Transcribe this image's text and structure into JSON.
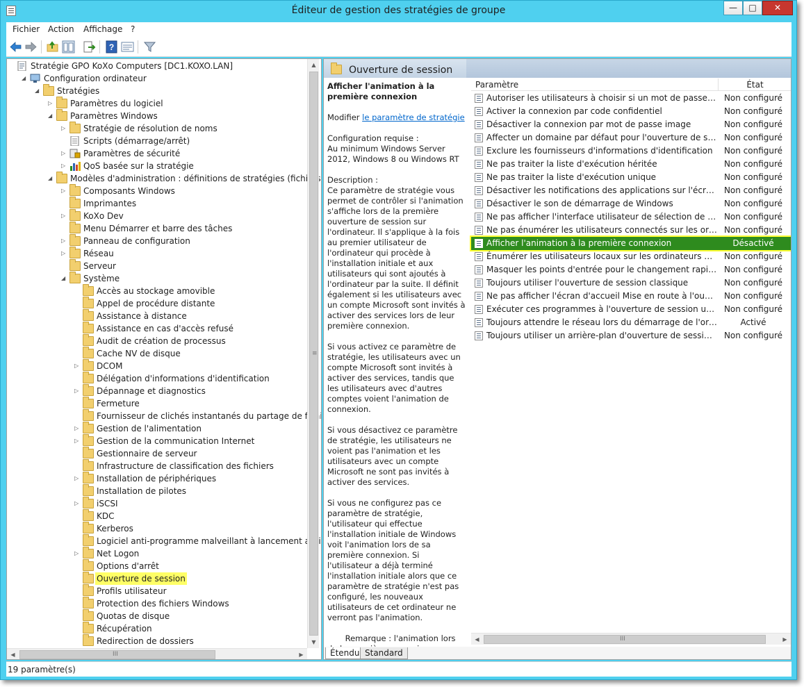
{
  "window": {
    "title": "Éditeur de gestion des stratégies de groupe",
    "min": "—",
    "max": "□",
    "close": "✕"
  },
  "menu": {
    "items": [
      "Fichier",
      "Action",
      "Affichage",
      "?"
    ]
  },
  "toolbar": {
    "icons": [
      "back-icon",
      "forward-icon",
      "up-folder-icon",
      "show-hide-tree-icon",
      "export-list-icon",
      "help-icon",
      "properties-icon",
      "filter-icon"
    ]
  },
  "tree": {
    "items": [
      {
        "label": "Stratégie GPO KoXo Computers [DC1.KOXO.LAN]",
        "icon": "policy-icon",
        "expander": ""
      },
      {
        "label": "Configuration ordinateur",
        "icon": "computer-icon",
        "expander": "◢"
      },
      {
        "label": "Stratégies",
        "icon": "folder-icon",
        "expander": "◢"
      },
      {
        "label": "Paramètres du logiciel",
        "icon": "folder-icon",
        "expander": "▷"
      },
      {
        "label": "Paramètres Windows",
        "icon": "folder-icon",
        "expander": "◢"
      },
      {
        "label": "Stratégie de résolution de noms",
        "icon": "folder-icon",
        "expander": "▷"
      },
      {
        "label": "Scripts (démarrage/arrêt)",
        "icon": "script-icon",
        "expander": ""
      },
      {
        "label": "Paramètres de sécurité",
        "icon": "security-icon",
        "expander": "▷"
      },
      {
        "label": "QoS basée sur la stratégie",
        "icon": "qos-chart-icon",
        "expander": "▷"
      },
      {
        "label": "Modèles d'administration : définitions de stratégies (fichiers ADMX",
        "icon": "folder-icon",
        "expander": "◢"
      },
      {
        "label": "Composants Windows",
        "icon": "folder-icon",
        "expander": "▷"
      },
      {
        "label": "Imprimantes",
        "icon": "folder-icon",
        "expander": ""
      },
      {
        "label": "KoXo Dev",
        "icon": "folder-icon",
        "expander": "▷"
      },
      {
        "label": "Menu Démarrer et barre des tâches",
        "icon": "folder-icon",
        "expander": ""
      },
      {
        "label": "Panneau de configuration",
        "icon": "folder-icon",
        "expander": "▷"
      },
      {
        "label": "Réseau",
        "icon": "folder-icon",
        "expander": "▷"
      },
      {
        "label": "Serveur",
        "icon": "folder-icon",
        "expander": ""
      },
      {
        "label": "Système",
        "icon": "folder-icon",
        "expander": "◢"
      },
      {
        "label": "Accès au stockage amovible",
        "icon": "folder-icon",
        "expander": ""
      },
      {
        "label": "Appel de procédure distante",
        "icon": "folder-icon",
        "expander": ""
      },
      {
        "label": "Assistance à distance",
        "icon": "folder-icon",
        "expander": ""
      },
      {
        "label": "Assistance en cas d'accès refusé",
        "icon": "folder-icon",
        "expander": ""
      },
      {
        "label": "Audit de création de processus",
        "icon": "folder-icon",
        "expander": ""
      },
      {
        "label": "Cache NV de disque",
        "icon": "folder-icon",
        "expander": ""
      },
      {
        "label": "DCOM",
        "icon": "folder-icon",
        "expander": "▷"
      },
      {
        "label": "Délégation d'informations d'identification",
        "icon": "folder-icon",
        "expander": ""
      },
      {
        "label": "Dépannage et diagnostics",
        "icon": "folder-icon",
        "expander": "▷"
      },
      {
        "label": "Fermeture",
        "icon": "folder-icon",
        "expander": ""
      },
      {
        "label": "Fournisseur de clichés instantanés du partage de fichiers",
        "icon": "folder-icon",
        "expander": ""
      },
      {
        "label": "Gestion de l'alimentation",
        "icon": "folder-icon",
        "expander": "▷"
      },
      {
        "label": "Gestion de la communication Internet",
        "icon": "folder-icon",
        "expander": "▷"
      },
      {
        "label": "Gestionnaire de serveur",
        "icon": "folder-icon",
        "expander": ""
      },
      {
        "label": "Infrastructure de classification des fichiers",
        "icon": "folder-icon",
        "expander": ""
      },
      {
        "label": "Installation de périphériques",
        "icon": "folder-icon",
        "expander": "▷"
      },
      {
        "label": "Installation de pilotes",
        "icon": "folder-icon",
        "expander": ""
      },
      {
        "label": "iSCSI",
        "icon": "folder-icon",
        "expander": "▷"
      },
      {
        "label": "KDC",
        "icon": "folder-icon",
        "expander": ""
      },
      {
        "label": "Kerberos",
        "icon": "folder-icon",
        "expander": ""
      },
      {
        "label": "Logiciel anti-programme malveillant à lancement anticipé",
        "icon": "folder-icon",
        "expander": ""
      },
      {
        "label": "Net Logon",
        "icon": "folder-icon",
        "expander": "▷"
      },
      {
        "label": "Options d'arrêt",
        "icon": "folder-icon",
        "expander": ""
      },
      {
        "label": "Ouverture de session",
        "icon": "folder-icon",
        "expander": "",
        "selected": true
      },
      {
        "label": "Profils utilisateur",
        "icon": "folder-icon",
        "expander": ""
      },
      {
        "label": "Protection des fichiers Windows",
        "icon": "folder-icon",
        "expander": ""
      },
      {
        "label": "Quotas de disque",
        "icon": "folder-icon",
        "expander": ""
      },
      {
        "label": "Récupération",
        "icon": "folder-icon",
        "expander": ""
      },
      {
        "label": "Redirection de dossiers",
        "icon": "folder-icon",
        "expander": ""
      }
    ]
  },
  "right": {
    "header_title": "Ouverture de session",
    "desc_title": "Afficher l'animation à la première connexion",
    "modify_prefix": "Modifier ",
    "modify_link": "le paramètre de stratégie",
    "req_label": "Configuration requise :",
    "req_text": "Au minimum Windows Server 2012, Windows 8 ou Windows RT",
    "desc_label": "Description :",
    "desc_p1": "Ce paramètre de stratégie vous permet de contrôler si l'animation s'affiche lors de la première ouverture de session sur l'ordinateur.  Il s'applique à la fois au premier utilisateur de l'ordinateur qui procède à l'installation initiale et aux utilisateurs qui sont ajoutés à l'ordinateur par la suite.  Il définit également si les utilisateurs avec un compte Microsoft sont invités à activer des services lors de leur première connexion.",
    "desc_p2": "Si vous activez ce paramètre de stratégie, les utilisateurs avec un compte Microsoft sont invités à activer des services, tandis que les utilisateurs avec d'autres comptes voient l'animation de connexion.",
    "desc_p3": "Si vous désactivez ce paramètre de stratégie, les utilisateurs ne voient pas l'animation et les utilisateurs avec un compte Microsoft ne sont pas invités à activer des services.",
    "desc_p4": "Si vous ne configurez pas ce paramètre de stratégie, l'utilisateur qui effectue l'installation initiale de Windows voit l'animation lors de sa première connexion. Si l'utilisateur a déjà terminé l'installation initiale alors que ce paramètre de stratégie n'est pas configuré, les nouveaux utilisateurs de cet ordinateur ne verront pas l'animation.",
    "desc_p5": "       Remarque : l'animation lors de la première connexion ne s'affiche pas sur la version Server. Cette stratégie n'a alors aucun effet.",
    "col_param": "Paramètre",
    "col_state": "État",
    "rows": [
      {
        "name": "Autoriser les utilisateurs à choisir si un mot de passe est requ...",
        "state": "Non configuré"
      },
      {
        "name": "Activer la connexion par code confidentiel",
        "state": "Non configuré"
      },
      {
        "name": "Désactiver la connexion par mot de passe image",
        "state": "Non configuré"
      },
      {
        "name": "Affecter un domaine par défaut pour l'ouverture de session",
        "state": "Non configuré"
      },
      {
        "name": "Exclure les fournisseurs d'informations d'identification",
        "state": "Non configuré"
      },
      {
        "name": "Ne pas traiter la liste d'exécution héritée",
        "state": "Non configuré"
      },
      {
        "name": "Ne pas traiter la liste d'exécution unique",
        "state": "Non configuré"
      },
      {
        "name": "Désactiver les notifications des applications sur l'écran de ve...",
        "state": "Non configuré"
      },
      {
        "name": "Désactiver le son de démarrage de Windows",
        "state": "Non configuré"
      },
      {
        "name": "Ne pas afficher l'interface utilisateur de sélection de réseau",
        "state": "Non configuré"
      },
      {
        "name": "Ne pas énumérer les utilisateurs connectés sur les ordinateu...",
        "state": "Non configuré"
      },
      {
        "name": "Afficher l'animation à la première connexion",
        "state": "Désactivé",
        "selected": true
      },
      {
        "name": "Énumérer les utilisateurs locaux sur les ordinateurs membres...",
        "state": "Non configuré"
      },
      {
        "name": "Masquer les points d'entrée pour le changement rapide d'ut...",
        "state": "Non configuré"
      },
      {
        "name": "Toujours utiliser l'ouverture de session classique",
        "state": "Non configuré"
      },
      {
        "name": "Ne pas afficher l'écran d'accueil Mise en route à l'ouverture ...",
        "state": "Non configuré"
      },
      {
        "name": "Exécuter ces programmes à l'ouverture de session utilisateur",
        "state": "Non configuré"
      },
      {
        "name": "Toujours attendre le réseau lors du démarrage de l'ordinate...",
        "state": "Activé"
      },
      {
        "name": "Toujours utiliser un arrière-plan d'ouverture de session pers...",
        "state": "Non configuré"
      }
    ],
    "tab_extended": "Étendu",
    "tab_standard": "Standard"
  },
  "status": {
    "text": "19 paramètre(s)"
  },
  "colors": {
    "selected_row": "#2e8b1e",
    "highlight": "#ffff33",
    "window_frame": "#4fd0ef"
  }
}
